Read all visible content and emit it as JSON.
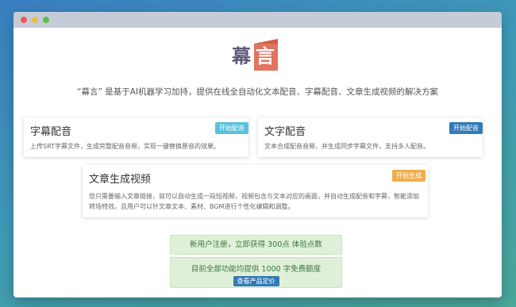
{
  "logo": {
    "char1": "幕",
    "char2": "言"
  },
  "tagline": "“幕言” 是基于AI机器学习加持，提供在线全自动化文本配音、字幕配音、文章生成视频的解决方案",
  "cards": [
    {
      "title": "字幕配音",
      "button": "开始配音",
      "desc": "上传SRT字幕文件，生成完整配音音频，实现一键替换原音的效果。"
    },
    {
      "title": "文字配音",
      "button": "开始配音",
      "desc": "文本合成配音音频，并生成同步字幕文件，支持多人配音。"
    },
    {
      "title": "文章生成视频",
      "button": "开始生成",
      "desc": "您只需要输入文章链接，就可以自动生成一段短视频，视频包含与文本对应的画面，并自动生成配音和字幕，智能添加转场特效。且用户可以针文章文本、素材、BGM进行个性化编辑和调整。"
    }
  ],
  "notices": {
    "signup": "新用户注册，立即获得 300点 体验点数",
    "free_quota": "目前全部功能均提供 1000 字免费额度",
    "pricing_button": "查看产品定价"
  },
  "colors": {
    "cyan_button": "#5bc0de",
    "blue_button": "#337ab7",
    "orange_button": "#f0ad4e",
    "logo_red": "#e2735f",
    "logo_purple": "#5b5878"
  }
}
